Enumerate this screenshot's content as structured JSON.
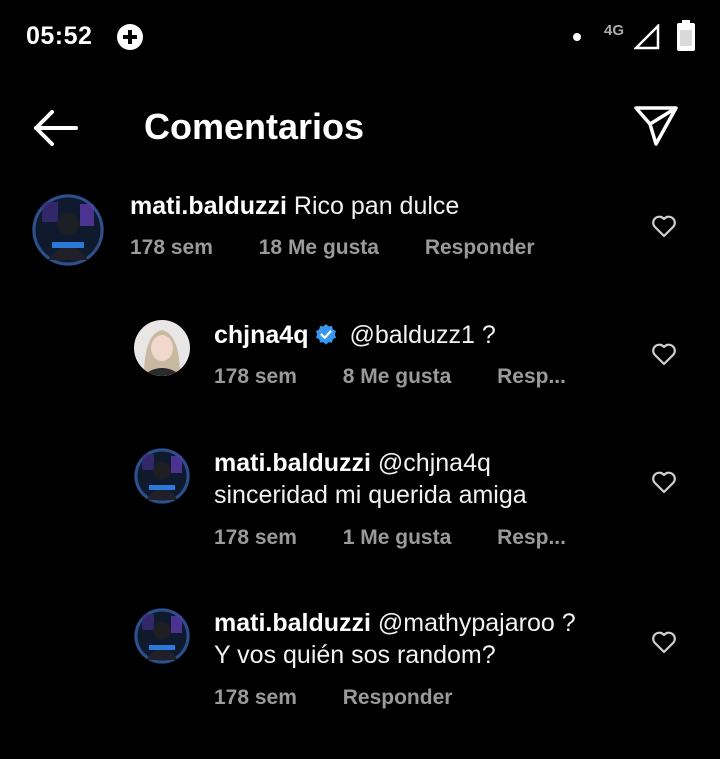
{
  "status_bar": {
    "time": "05:52",
    "network": "4G",
    "icons": [
      "plus-circle-icon",
      "dot-icon",
      "signal-icon",
      "battery-icon"
    ]
  },
  "header": {
    "title": "Comentarios",
    "back_icon": "arrow-left-icon",
    "share_icon": "send-icon"
  },
  "colors": {
    "background": "#000000",
    "text": "#f5f5f5",
    "meta": "#9a9a9a",
    "verified": "#3897f0"
  },
  "comments": [
    {
      "username": "mati.balduzzi",
      "verified": false,
      "text": "Rico pan dulce",
      "time": "178 sem",
      "likes": "18 Me gusta",
      "reply": "Responder"
    },
    {
      "username": "chjna4q",
      "verified": true,
      "text": "@balduzz1 ?",
      "time": "178 sem",
      "likes": "8 Me gusta",
      "reply": "Resp..."
    },
    {
      "username": "mati.balduzzi",
      "verified": false,
      "text_line1": "@chjna4q",
      "text_line2": "sinceridad mi querida amiga",
      "time": "178 sem",
      "likes": "1 Me gusta",
      "reply": "Resp..."
    },
    {
      "username": "mati.balduzzi",
      "verified": false,
      "text_line1": "@mathypajaroo ?",
      "text_line2": "Y vos quién sos random?",
      "time": "178 sem",
      "reply": "Responder"
    }
  ]
}
